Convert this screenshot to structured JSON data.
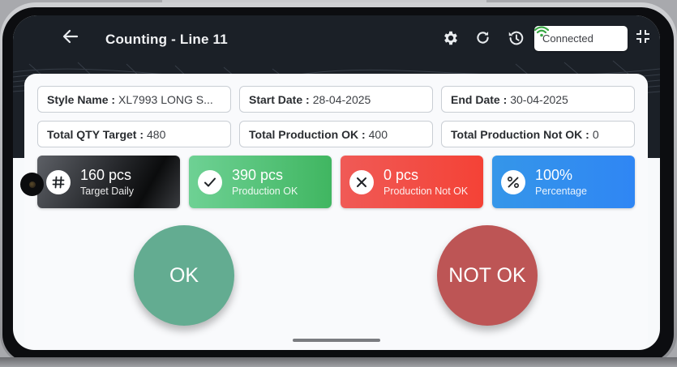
{
  "header": {
    "title": "Counting - Line 11",
    "status_text": "Connected",
    "icons": [
      "arrow-left-icon",
      "gear-icon",
      "refresh-icon",
      "history-icon",
      "wifi-icon",
      "collapse-icon"
    ]
  },
  "info": {
    "style_label": "Style Name :",
    "style_value": "XL7993 LONG S...",
    "start_label": "Start Date :",
    "start_value": "28-04-2025",
    "end_label": "End Date :",
    "end_value": "30-04-2025",
    "qty_label": "Total QTY Target :",
    "qty_value": "480",
    "prod_ok_label": "Total Production OK :",
    "prod_ok_value": "400",
    "prod_notok_label": "Total Production Not OK :",
    "prod_notok_value": "0"
  },
  "stats": {
    "target": {
      "value": "160 pcs",
      "label": "Target Daily",
      "icon": "hash-icon"
    },
    "ok": {
      "value": "390 pcs",
      "label": "Production OK",
      "icon": "check-icon"
    },
    "notok": {
      "value": "0 pcs",
      "label": "Production Not OK",
      "icon": "close-icon"
    },
    "percentage": {
      "value": "100%",
      "label": "Percentage",
      "icon": "percent-icon"
    }
  },
  "actions": {
    "ok_label": "OK",
    "notok_label": "NOT OK"
  },
  "colors": {
    "ok_button": "#63ac91",
    "notok_button": "#bd5555",
    "wifi": "#3aa845"
  }
}
